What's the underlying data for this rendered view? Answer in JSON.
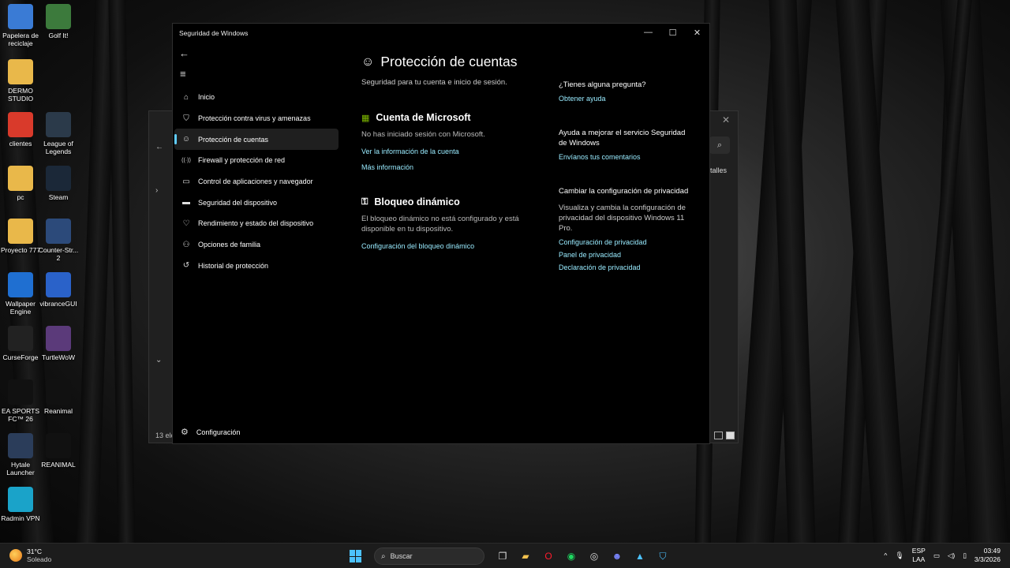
{
  "desktop": {
    "icons": [
      {
        "label": "Papelera de reciclaje",
        "icon": "recycle-bin-icon",
        "color": "#3a7bd5"
      },
      {
        "label": "Golf It!",
        "icon": "golf-it-icon",
        "color": "#3c7a3c"
      },
      {
        "label": "DERMO STUDIO",
        "icon": "folder-icon",
        "color": "#e9b84a"
      },
      {
        "label": "clientes",
        "icon": "clientes-icon",
        "color": "#d93a2b"
      },
      {
        "label": "League of Legends",
        "icon": "league-of-legends-icon",
        "color": "#2b3a4a"
      },
      {
        "label": "pc",
        "icon": "folder-icon",
        "color": "#e9b84a"
      },
      {
        "label": "Steam",
        "icon": "steam-icon",
        "color": "#1b2838"
      },
      {
        "label": "Proyecto 777",
        "icon": "folder-icon",
        "color": "#e9b84a"
      },
      {
        "label": "Counter-Str... 2",
        "icon": "counter-strike-icon",
        "color": "#2c4a7a"
      },
      {
        "label": "Wallpaper Engine",
        "icon": "wallpaper-engine-icon",
        "color": "#1f6fd1"
      },
      {
        "label": "vibranceGUI",
        "icon": "vibrancegui-icon",
        "color": "#2a62c9"
      },
      {
        "label": "CurseForge",
        "icon": "curseforge-icon",
        "color": "#222"
      },
      {
        "label": "TurtleWoW",
        "icon": "turtlewow-icon",
        "color": "#5b3a7a"
      },
      {
        "label": "EA SPORTS FC™ 26",
        "icon": "ea-sports-fc-icon",
        "color": "#111"
      },
      {
        "label": "Reanimal",
        "icon": "reanimal-icon",
        "color": "#111"
      },
      {
        "label": "Hytale Launcher",
        "icon": "hytale-icon",
        "color": "#2b3d5a"
      },
      {
        "label": "REANIMAL",
        "icon": "reanimal-icon",
        "color": "#111"
      },
      {
        "label": "Radmin VPN",
        "icon": "radmin-vpn-icon",
        "color": "#1aa3c9"
      }
    ]
  },
  "bg_window": {
    "close": "✕",
    "search": "⌕",
    "detalles": "etalles",
    "count": "13 ele"
  },
  "window": {
    "title": "Seguridad de Windows",
    "minimize": "—",
    "maximize": "☐",
    "close": "✕"
  },
  "nav": {
    "back": "←",
    "menu": "≡",
    "items": [
      {
        "label": "Inicio",
        "icon": "⌂"
      },
      {
        "label": "Protección contra virus y amenazas",
        "icon": "⛉"
      },
      {
        "label": "Protección de cuentas",
        "icon": "☺"
      },
      {
        "label": "Firewall y protección de red",
        "icon": "((·))"
      },
      {
        "label": "Control de aplicaciones y navegador",
        "icon": "▭"
      },
      {
        "label": "Seguridad del dispositivo",
        "icon": "▬"
      },
      {
        "label": "Rendimiento y estado del dispositivo",
        "icon": "♡"
      },
      {
        "label": "Opciones de familia",
        "icon": "⚇"
      },
      {
        "label": "Historial de protección",
        "icon": "↺"
      }
    ],
    "settings": "Configuración",
    "settings_icon": "⚙"
  },
  "main": {
    "title": "Protección de cuentas",
    "title_icon": "☺",
    "subtitle": "Seguridad para tu cuenta e inicio de sesión.",
    "microsoft": {
      "heading": "Cuenta de Microsoft",
      "icon": "▦",
      "text": "No has iniciado sesión con Microsoft.",
      "link1": "Ver la información de la cuenta",
      "link2": "Más información"
    },
    "dynamic_lock": {
      "heading": "Bloqueo dinámico",
      "icon": "⚿",
      "text": "El bloqueo dinámico no está configurado y está disponible en tu dispositivo.",
      "link": "Configuración del bloqueo dinámico"
    }
  },
  "side": {
    "question": {
      "heading": "¿Tienes alguna pregunta?",
      "link": "Obtener ayuda"
    },
    "improve": {
      "heading": "Ayuda a mejorar el servicio Seguridad de Windows",
      "link": "Envíanos tus comentarios"
    },
    "privacy": {
      "heading": "Cambiar la configuración de privacidad",
      "text": "Visualiza y cambia la configuración de privacidad del dispositivo Windows 11 Pro.",
      "link1": "Configuración de privacidad",
      "link2": "Panel de privacidad",
      "link3": "Declaración de privacidad"
    }
  },
  "taskbar": {
    "temp": "31°C",
    "weather": "Soleado",
    "search": "Buscar",
    "apps": [
      {
        "name": "task-view-icon",
        "glyph": "❐",
        "color": "#ddd"
      },
      {
        "name": "file-explorer-icon",
        "glyph": "▰",
        "color": "#f2c14e"
      },
      {
        "name": "opera-icon",
        "glyph": "O",
        "color": "#ff1b2d"
      },
      {
        "name": "spotify-icon",
        "glyph": "◉",
        "color": "#1ed760"
      },
      {
        "name": "chrome-icon",
        "glyph": "◎",
        "color": "#ddd"
      },
      {
        "name": "discord-icon",
        "glyph": "☻",
        "color": "#7a86ff"
      },
      {
        "name": "photos-icon",
        "glyph": "▲",
        "color": "#4cc2ff"
      },
      {
        "name": "windows-security-icon",
        "glyph": "⛉",
        "color": "#4cc2ff"
      }
    ],
    "tray_arrow": "^",
    "mic": "🎙",
    "lang1": "ESP",
    "lang2": "LAA",
    "time": "03:49",
    "date": "3/3/2026"
  }
}
